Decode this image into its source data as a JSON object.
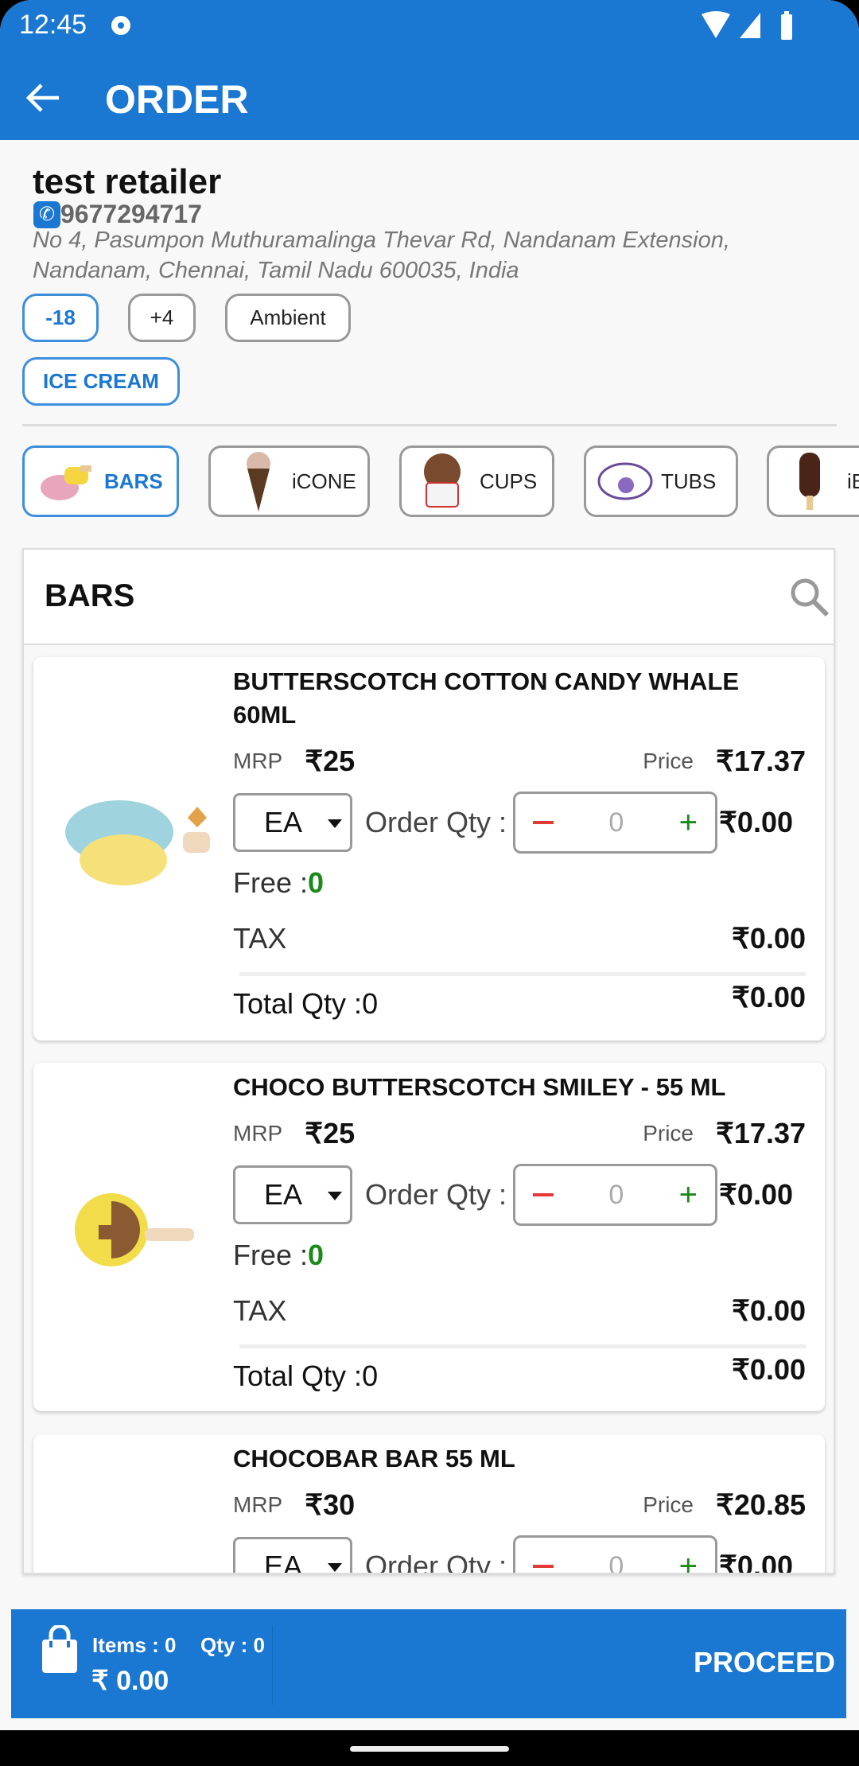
{
  "status_bar": {
    "time": "12:45",
    "icons": [
      "media-icon",
      "wifi-icon",
      "signal-icon",
      "battery-icon"
    ]
  },
  "app_bar": {
    "title": "ORDER",
    "back_icon": "arrow-left-icon"
  },
  "retailer": {
    "name": "test retailer",
    "phone": "9677294717",
    "address": "No 4, Pasumpon Muthuramalinga Thevar Rd, Nandanam Extension, Nandanam, Chennai, Tamil Nadu 600035, India"
  },
  "temperature_chips": [
    {
      "label": "-18",
      "selected": true
    },
    {
      "label": "+4",
      "selected": false
    },
    {
      "label": "Ambient",
      "selected": false
    }
  ],
  "division_chip": {
    "label": "ICE CREAM",
    "selected": true
  },
  "categories": [
    {
      "label": "BARS",
      "selected": true
    },
    {
      "label": "iCONE"
    },
    {
      "label": "CUPS"
    },
    {
      "label": "TUBS"
    },
    {
      "label": "iB"
    }
  ],
  "list": {
    "header": "BARS",
    "search_icon": "search-icon"
  },
  "labels": {
    "mrp": "MRP",
    "price": "Price",
    "order_qty": "Order Qty :",
    "free": "Free : ",
    "tax": "TAX",
    "total_qty": "Total Qty : "
  },
  "products": [
    {
      "name": "BUTTERSCOTCH COTTON CANDY WHALE 60ML",
      "mrp": "₹25",
      "price": "₹17.37",
      "uom": "EA",
      "qty": "0",
      "amount": "₹0.00",
      "free": "0",
      "tax": "₹0.00",
      "total_qty": "0",
      "total": "₹0.00"
    },
    {
      "name": "CHOCO BUTTERSCOTCH SMILEY - 55 ML",
      "mrp": "₹25",
      "price": "₹17.37",
      "uom": "EA",
      "qty": "0",
      "amount": "₹0.00",
      "free": "0",
      "tax": "₹0.00",
      "total_qty": "0",
      "total": "₹0.00"
    },
    {
      "name": "CHOCOBAR BAR 55 ML",
      "mrp": "₹30",
      "price": "₹20.85",
      "uom": "EA",
      "qty": "0",
      "amount": "₹0.00"
    }
  ],
  "bottom_bar": {
    "items": "Items : 0",
    "qty": "Qty : 0",
    "total": "₹ 0.00",
    "proceed": "PROCEED"
  },
  "colors": {
    "primary": "#1a77d2",
    "free_green": "#1a8a1a",
    "minus_red": "#e53935"
  }
}
